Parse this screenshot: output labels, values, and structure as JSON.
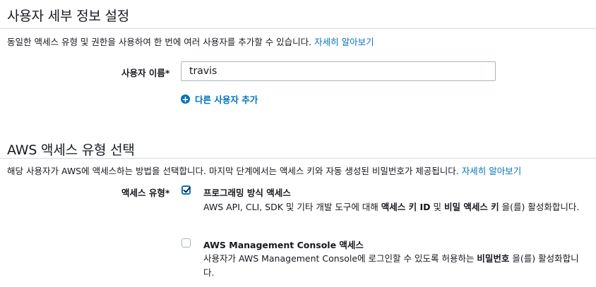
{
  "user_details": {
    "title": "사용자 세부 정보 설정",
    "description": "동일한 액세스 유형 및 권한을 사용하여 한 번에 여러 사용자를 추가할 수 있습니다.",
    "learn_more": "자세히 알아보기",
    "username_label": "사용자 이름*",
    "username_value": "travis",
    "add_user_label": "다른 사용자 추가"
  },
  "access_type": {
    "title": "AWS 액세스 유형 선택",
    "description": "해당 사용자가 AWS에 액세스하는 방법을 선택합니다. 마지막 단계에서는 액세스 키와 자동 생성된 비밀번호가 제공됩니다.",
    "learn_more": "자세히 알아보기",
    "label": "액세스 유형*",
    "options": [
      {
        "title": "프로그래밍 방식 액세스",
        "checked": true,
        "desc_pre": "AWS API, CLI, SDK 및 기타 개발 도구에 대해 ",
        "desc_bold1": "액세스 키 ID",
        "desc_mid": " 및 ",
        "desc_bold2": "비밀 액세스 키",
        "desc_post": " 을(를) 활성화합니다."
      },
      {
        "title": "AWS Management Console 액세스",
        "checked": false,
        "desc_pre": "사용자가 AWS Management Console에 로그인할 수 있도록 허용하는 ",
        "desc_bold1": "비밀번호",
        "desc_post": " 을(를) 활성화합니다."
      }
    ]
  },
  "colors": {
    "link": "#0073bb",
    "text": "#16191f",
    "divider": "#d5dbdb"
  }
}
